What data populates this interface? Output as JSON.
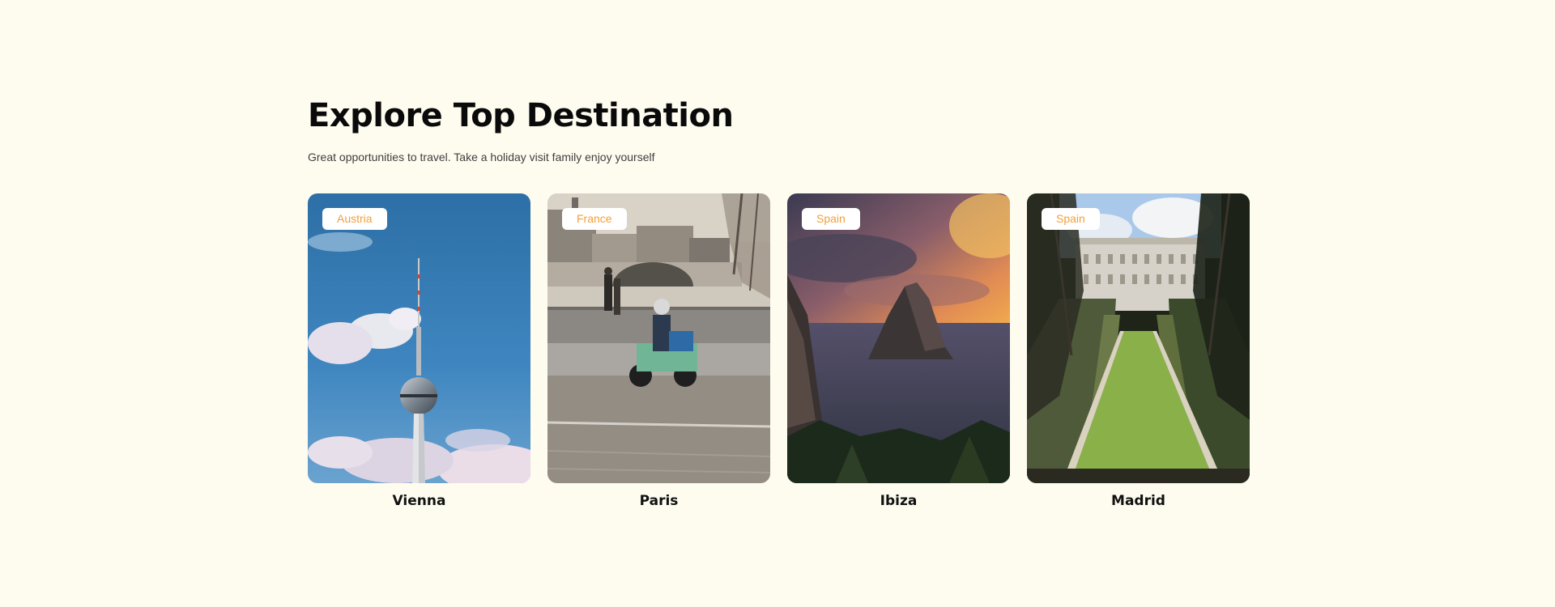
{
  "section": {
    "title": "Explore Top Destination",
    "subtitle": "Great opportunities to travel. Take a holiday visit family enjoy yourself"
  },
  "destinations": [
    {
      "country": "Austria",
      "city": "Vienna",
      "image": "tv-tower-photo"
    },
    {
      "country": "France",
      "city": "Paris",
      "image": "scooter-street-photo"
    },
    {
      "country": "Spain",
      "city": "Ibiza",
      "image": "sea-rock-sunset-photo"
    },
    {
      "country": "Spain",
      "city": "Madrid",
      "image": "palace-garden-photo"
    }
  ],
  "colors": {
    "background": "#fefcef",
    "badge_text": "#f2a03d",
    "badge_bg": "#ffffff"
  }
}
